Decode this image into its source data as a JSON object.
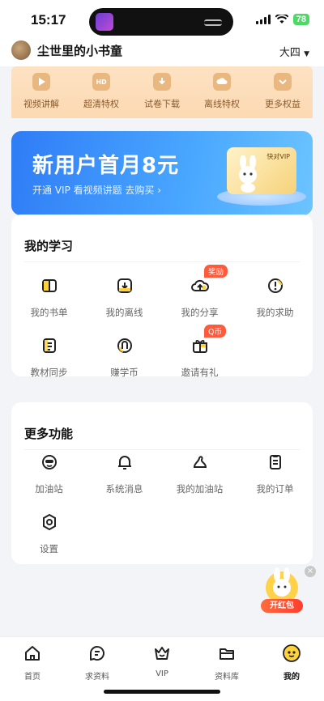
{
  "status_bar": {
    "time": "15:17",
    "battery": "78"
  },
  "header": {
    "username": "尘世里的小书童",
    "grade": "大四"
  },
  "vip_strip": {
    "items": [
      {
        "label": "视频讲解",
        "icon": "play-icon"
      },
      {
        "label": "超清特权",
        "icon": "hd-icon"
      },
      {
        "label": "试卷下载",
        "icon": "download-icon"
      },
      {
        "label": "离线特权",
        "icon": "offline-icon"
      },
      {
        "label": "更多权益",
        "icon": "chevron-down-icon"
      }
    ]
  },
  "banner": {
    "title": "新用户首月8元",
    "subtitle": "开通 VIP 看视频讲题 去购买 ›",
    "card_text": "快对VIP"
  },
  "my_study": {
    "title": "我的学习",
    "items": [
      {
        "label": "我的书单",
        "icon": "book-icon",
        "badge": ""
      },
      {
        "label": "我的离线",
        "icon": "offline-download-icon",
        "badge": ""
      },
      {
        "label": "我的分享",
        "icon": "cloud-upload-icon",
        "badge": "奖励"
      },
      {
        "label": "我的求助",
        "icon": "help-bubble-icon",
        "badge": ""
      },
      {
        "label": "教材同步",
        "icon": "textbook-icon",
        "badge": ""
      },
      {
        "label": "赚学币",
        "icon": "coin-icon",
        "badge": ""
      },
      {
        "label": "邀请有礼",
        "icon": "gift-icon",
        "badge": "Q币"
      }
    ]
  },
  "more_features": {
    "title": "更多功能",
    "items": [
      {
        "label": "加油站",
        "icon": "cheer-face-icon"
      },
      {
        "label": "系统消息",
        "icon": "bell-icon"
      },
      {
        "label": "我的加油站",
        "icon": "my-station-icon"
      },
      {
        "label": "我的订单",
        "icon": "order-icon"
      },
      {
        "label": "设置",
        "icon": "settings-icon"
      }
    ]
  },
  "float_promo": {
    "label": "开红包",
    "close": "×"
  },
  "tabbar": {
    "items": [
      {
        "label": "首页",
        "icon": "home-icon"
      },
      {
        "label": "求资料",
        "icon": "chat-icon"
      },
      {
        "label": "VIP",
        "icon": "crown-icon"
      },
      {
        "label": "资料库",
        "icon": "folder-icon"
      },
      {
        "label": "我的",
        "icon": "profile-face-icon"
      }
    ],
    "active_index": 4
  },
  "colors": {
    "accent_blue": "#2f7cf6",
    "badge_red": "#ff5a3c",
    "vip_gold": "#e9b780"
  }
}
